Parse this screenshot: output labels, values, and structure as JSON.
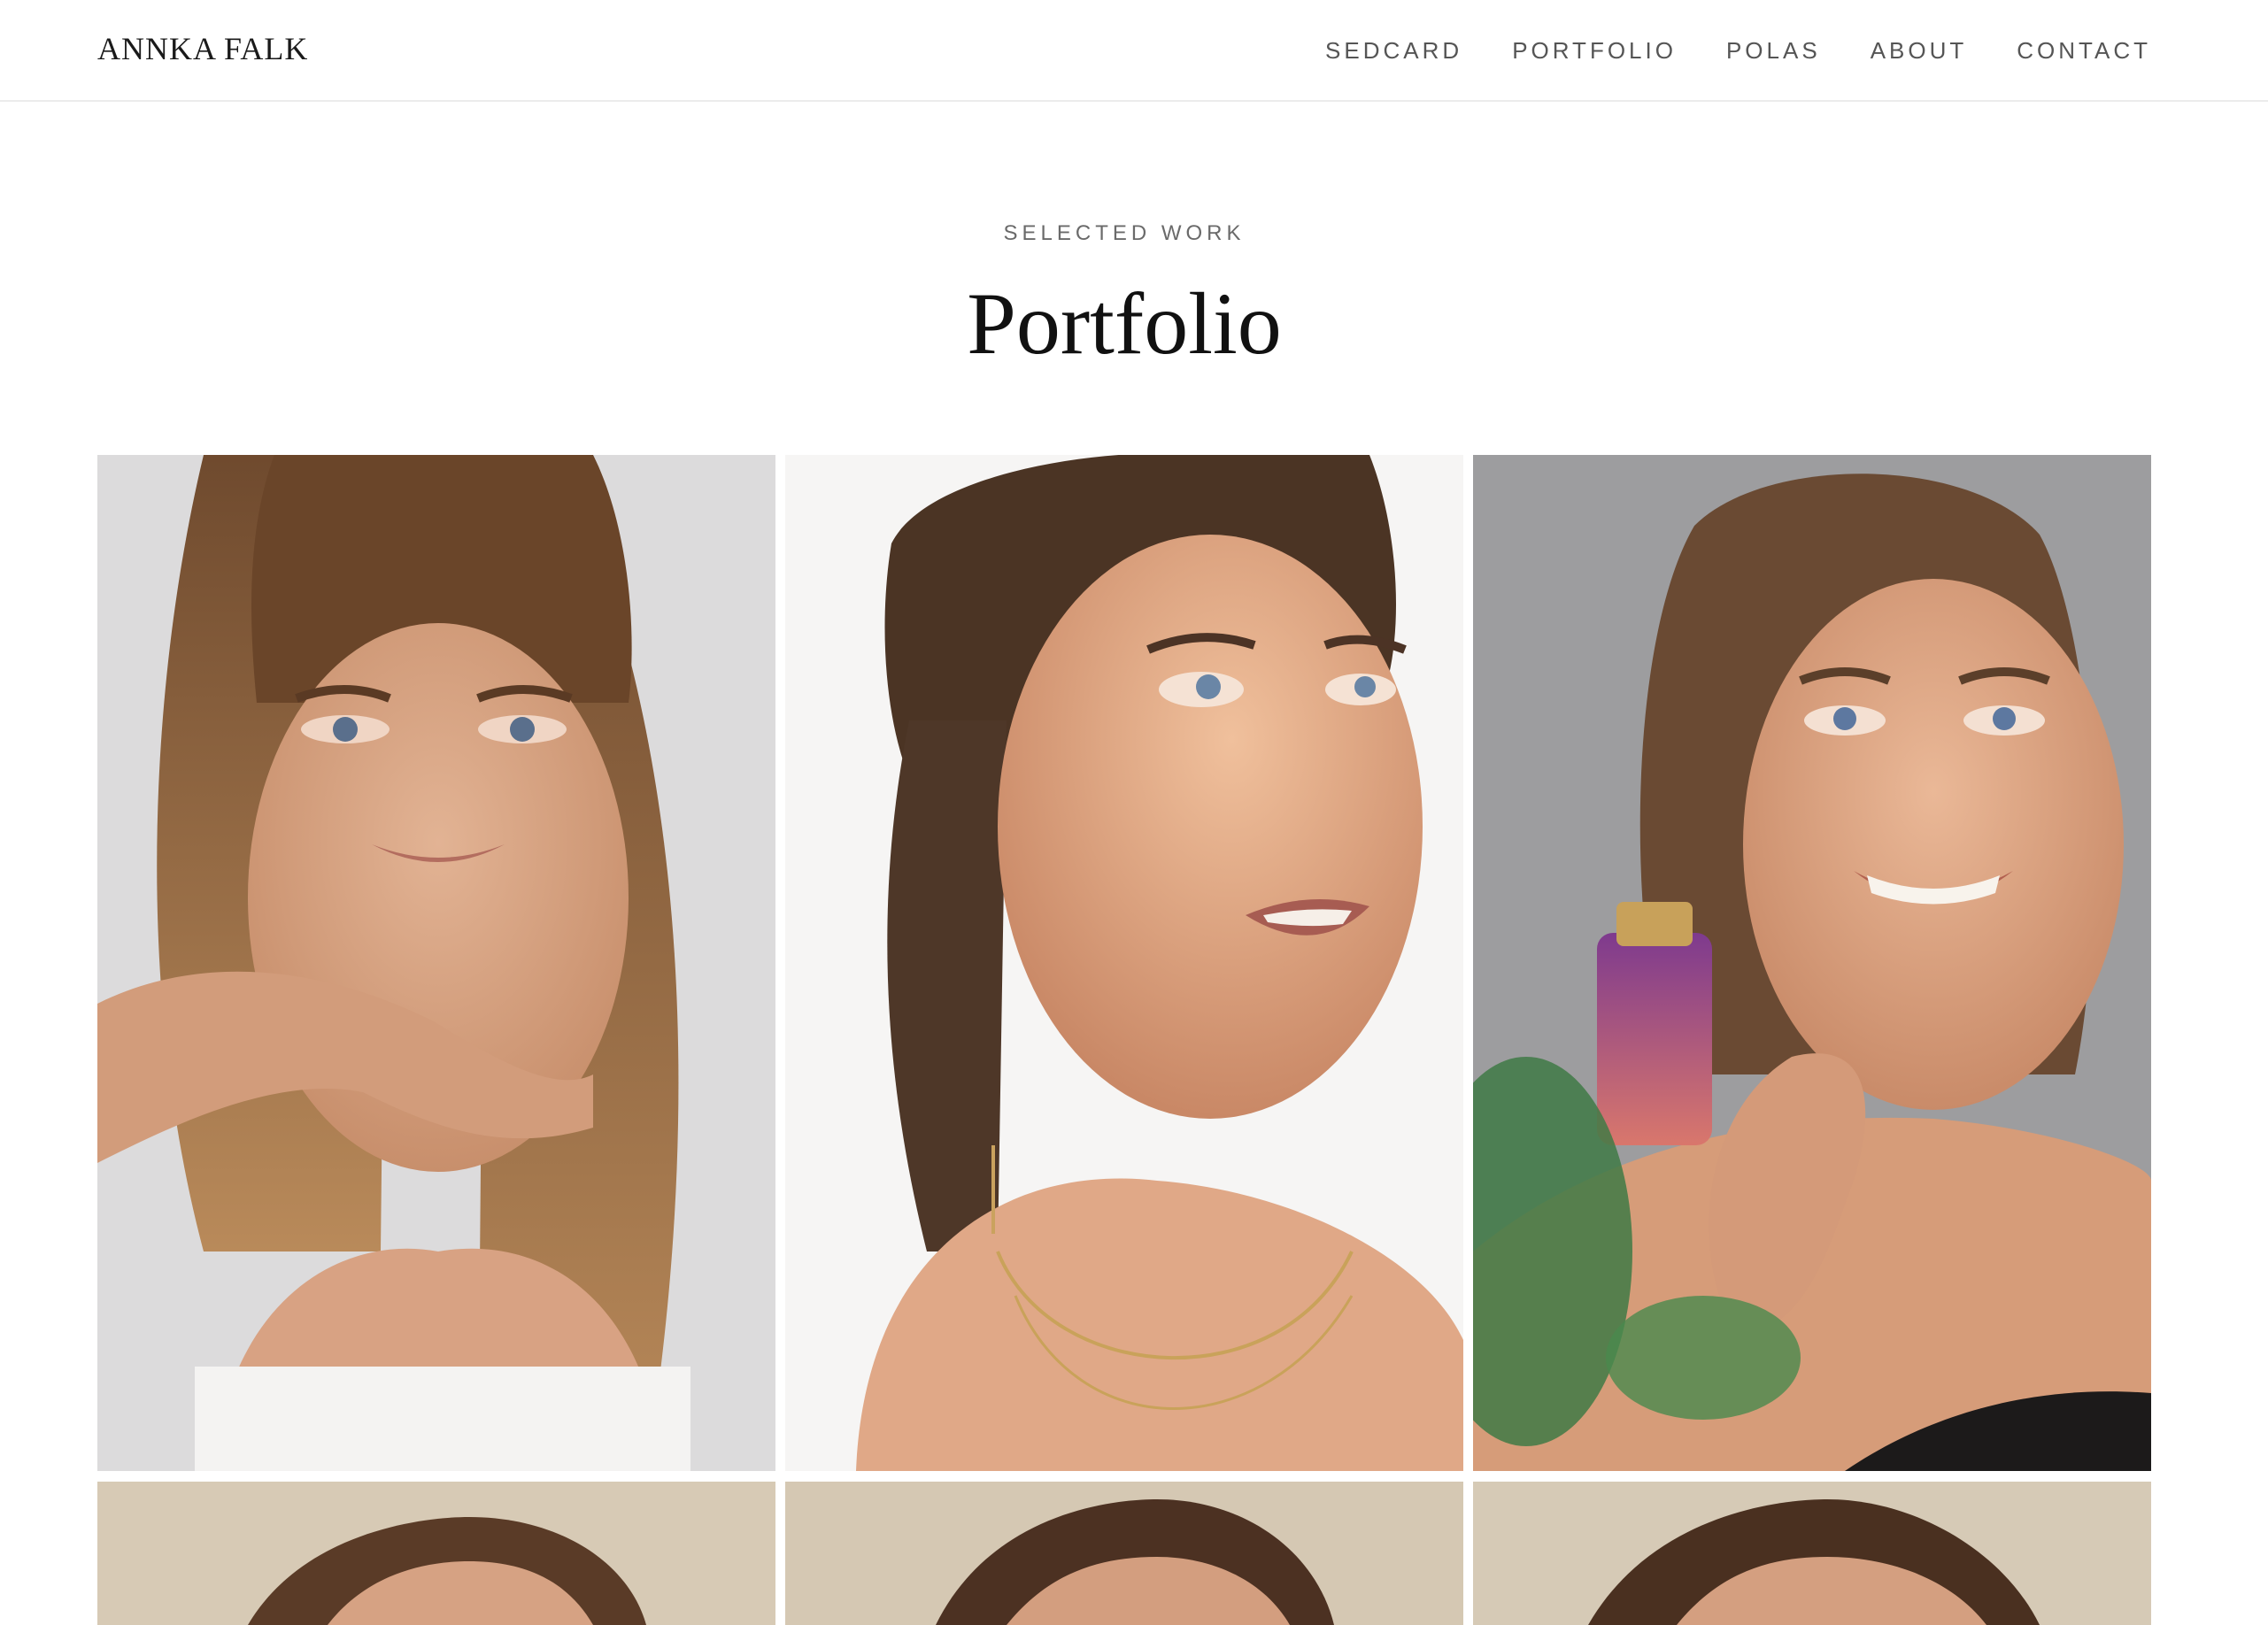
{
  "header": {
    "brand": "ANNKA FALK",
    "nav": [
      {
        "label": "SEDCARD"
      },
      {
        "label": "PORTFOLIO"
      },
      {
        "label": "POLAS"
      },
      {
        "label": "ABOUT"
      },
      {
        "label": "CONTACT"
      }
    ]
  },
  "main": {
    "eyebrow": "SELECTED WORK",
    "title": "Portfolio"
  },
  "gallery": {
    "photos": [
      {
        "subject": "portrait-hand-under-chin",
        "bg": "#d8d7d9"
      },
      {
        "subject": "portrait-looking-up-necklace",
        "bg": "#f7f6f5"
      },
      {
        "subject": "portrait-smiling-holding-bottle",
        "bg": "#9a9a9a"
      },
      {
        "subject": "portrait-beige-background",
        "bg": "#d8ccb8"
      },
      {
        "subject": "portrait-beige-background",
        "bg": "#d6c9b5"
      },
      {
        "subject": "portrait-beige-background",
        "bg": "#d7cbb7"
      }
    ]
  }
}
